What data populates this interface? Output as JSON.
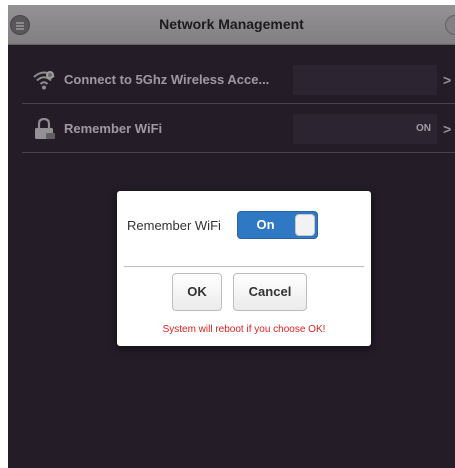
{
  "header": {
    "title": "Network Management"
  },
  "rows": [
    {
      "label": "Connect to 5Ghz Wireless Acce...",
      "value": "",
      "icon": "wifi-icon"
    },
    {
      "label": "Remember WiFi",
      "value": "ON",
      "icon": "lock-icon"
    }
  ],
  "dialog": {
    "label": "Remember WiFi",
    "toggle_label": "On",
    "toggle_state": true,
    "ok_label": "OK",
    "cancel_label": "Cancel",
    "warning": "System will reboot if you choose OK!"
  },
  "colors": {
    "background": "#2d2430",
    "toggle_on": "#2f78c3",
    "warning": "#e02020"
  }
}
